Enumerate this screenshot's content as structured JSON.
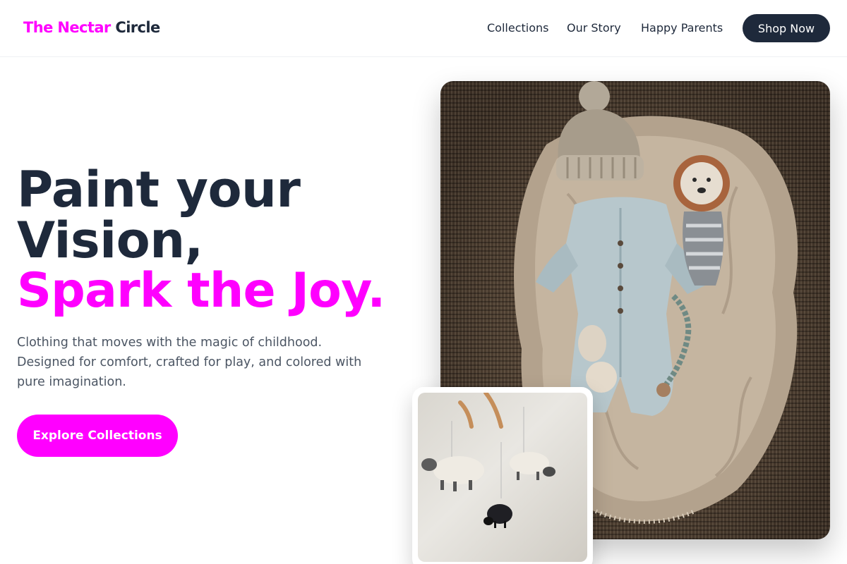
{
  "header": {
    "brand_part1": "The Nectar",
    "brand_part2": "Circle",
    "nav": [
      {
        "label": "Collections"
      },
      {
        "label": "Our Story"
      },
      {
        "label": "Happy Parents"
      }
    ],
    "cta_label": "Shop Now"
  },
  "hero": {
    "headline_line1": "Paint your",
    "headline_line2": "Vision,",
    "headline_accent": "Spark the Joy.",
    "description": "Clothing that moves with the magic of childhood. Designed for comfort, crafted for play, and colored with pure imagination.",
    "cta_label": "Explore Collections"
  },
  "colors": {
    "accent": "#ff00ff",
    "navy": "#1e293b",
    "text_muted": "#4b5563"
  }
}
